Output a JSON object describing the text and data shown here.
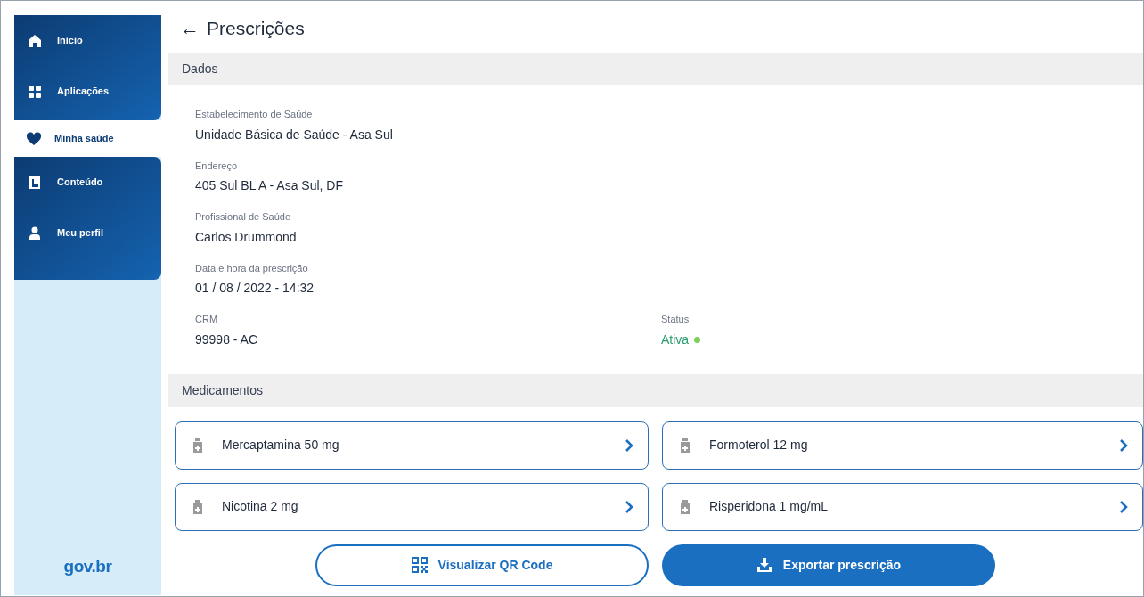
{
  "sidebar": {
    "items": [
      {
        "kind": "home",
        "label": "Início",
        "selected": false
      },
      {
        "kind": "apps",
        "label": "Aplicações",
        "selected": false
      },
      {
        "kind": "health",
        "label": "Minha saúde",
        "selected": true
      },
      {
        "kind": "content",
        "label": "Conteúdo",
        "selected": false
      },
      {
        "kind": "profile",
        "label": "Meu perfil",
        "selected": false
      }
    ],
    "logo": "gov.br"
  },
  "header": {
    "back": "←",
    "title": "Prescrições"
  },
  "dados": {
    "title": "Dados",
    "fields": [
      {
        "label": "Estabelecimento de Saúde",
        "value": "Unidade Básica de Saúde - Asa Sul"
      },
      {
        "label": "Endereço",
        "value": "405 Sul BL A - Asa Sul, DF"
      },
      {
        "label": "Profissional de Saúde",
        "value": "Carlos Drummond"
      },
      {
        "label": "Data e hora da prescrição",
        "value": "01 / 08 / 2022 - 14:32"
      }
    ],
    "crm": {
      "label": "CRM",
      "value": "99998 - AC"
    },
    "status": {
      "label": "Status",
      "value": "Ativa",
      "color": "#7ccf5a"
    }
  },
  "medicamentos": {
    "title": "Medicamentos",
    "items": [
      {
        "name": "Mercaptamina 50 mg"
      },
      {
        "name": "Formoterol 12 mg"
      },
      {
        "name": "Nicotina 2 mg"
      },
      {
        "name": "Risperidona 1 mg/mL"
      }
    ]
  },
  "buttons": [
    {
      "kind": "outline",
      "label": "Visualizar QR Code"
    },
    {
      "kind": "filled",
      "label": "Exportar prescrição"
    }
  ]
}
